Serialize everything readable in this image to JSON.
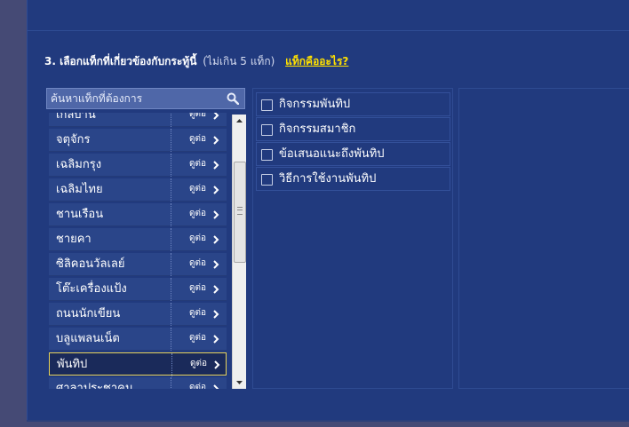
{
  "question": {
    "title": "3. เลือกแท็กที่เกี่ยวข้องกับกระทู้นี้",
    "hint": "(ไม่เกิน 5 แท็ก)",
    "link": "แท็กคืออะไร?"
  },
  "search": {
    "placeholder": "ค้นหาแท็กที่ต้องการ"
  },
  "room_list": {
    "more_label": "ดูต่อ",
    "items": [
      {
        "label": "เกลบาน"
      },
      {
        "label": "จตุจักร"
      },
      {
        "label": "เฉลิมกรุง"
      },
      {
        "label": "เฉลิมไทย"
      },
      {
        "label": "ชานเรือน"
      },
      {
        "label": "ชายคา"
      },
      {
        "label": "ซิลิคอนวัลเลย์"
      },
      {
        "label": "โต๊ะเครื่องแป้ง"
      },
      {
        "label": "ถนนนักเขียน"
      },
      {
        "label": "บลูแพลนเน็ต"
      },
      {
        "label": "พันทิป",
        "selected": true
      },
      {
        "label": "ศาลาประชาคม"
      }
    ]
  },
  "sub_tags": {
    "items": [
      {
        "label": "กิจกรรมพันทิป",
        "checked": false
      },
      {
        "label": "กิจกรรมสมาชิก",
        "checked": false
      },
      {
        "label": "ข้อเสนอแนะถึงพันทิป",
        "checked": false
      },
      {
        "label": "วิธีการใช้งานพันทิป",
        "checked": false
      }
    ]
  },
  "colors": {
    "panel": "#213a7e",
    "selected_border": "#e8d35a",
    "link": "#ffe000"
  },
  "icons": {
    "search": "search-icon",
    "more": "chevron-right-icon",
    "scroll_up": "arrow-up-icon",
    "scroll_down": "arrow-down-icon"
  }
}
